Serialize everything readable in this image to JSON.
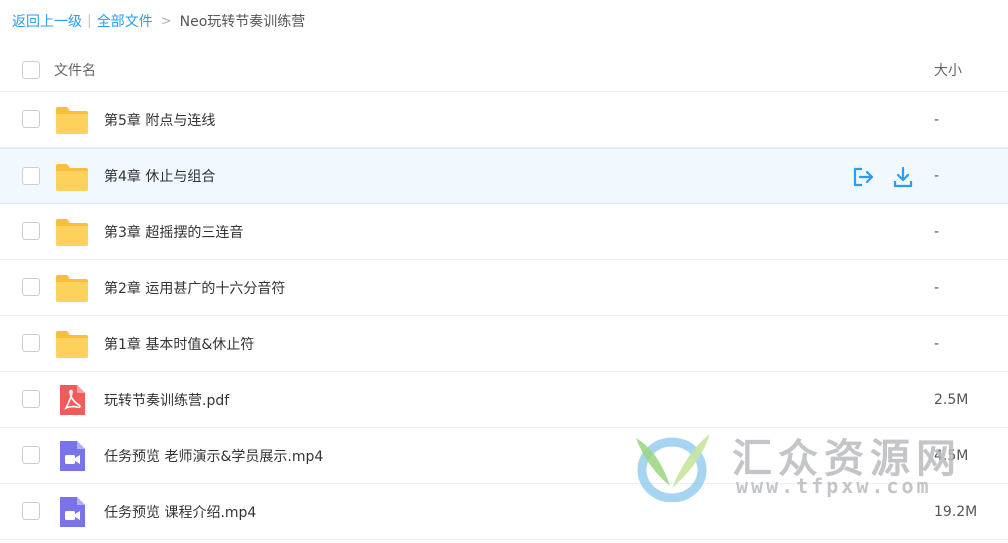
{
  "breadcrumb": {
    "back": "返回上一级",
    "all_files": "全部文件",
    "separator": ">",
    "current": "Neo玩转节奏训练营"
  },
  "header": {
    "name_label": "文件名",
    "size_label": "大小"
  },
  "files": [
    {
      "type": "folder",
      "icon": "folder-icon",
      "name": "第5章 附点与连线",
      "size": "-"
    },
    {
      "type": "folder",
      "icon": "folder-icon",
      "name": "第4章 休止与组合",
      "size": "-",
      "hover": true
    },
    {
      "type": "folder",
      "icon": "folder-icon",
      "name": "第3章 超摇摆的三连音",
      "size": "-"
    },
    {
      "type": "folder",
      "icon": "folder-icon",
      "name": "第2章 运用甚广的十六分音符",
      "size": "-"
    },
    {
      "type": "folder",
      "icon": "folder-icon",
      "name": "第1章 基本时值&休止符",
      "size": "-"
    },
    {
      "type": "pdf",
      "icon": "pdf-icon",
      "name": "玩转节奏训练营.pdf",
      "size": "2.5M"
    },
    {
      "type": "video",
      "icon": "video-icon",
      "name": "任务预览 老师演示&学员展示.mp4",
      "size": "4.5M"
    },
    {
      "type": "video",
      "icon": "video-icon",
      "name": "任务预览 课程介绍.mp4",
      "size": "19.2M"
    }
  ],
  "row_actions": {
    "share_icon": "share-icon",
    "download_icon": "download-icon"
  },
  "watermark": {
    "title": "汇众资源网",
    "url": "www.tfpxw.com"
  },
  "colors": {
    "link": "#2a9df4",
    "folder": "#fcd25c",
    "pdf": "#f25b5b",
    "video": "#7a72e8",
    "hover_row": "#f1f8fe"
  }
}
